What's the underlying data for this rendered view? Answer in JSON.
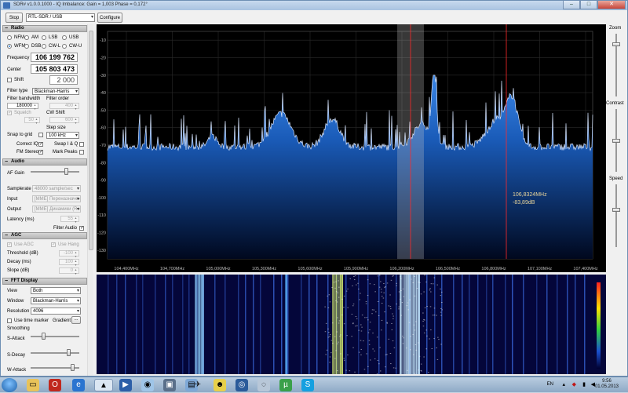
{
  "window": {
    "title": "SDR# v1.0.0.1000 - IQ Imbalance: Gain = 1,003 Phase = 0,172°",
    "minimize": "–",
    "maximize": "□",
    "close": "✕"
  },
  "toolbar": {
    "stop_label": "Stop",
    "device": "RTL-SDR / USB",
    "configure_label": "Configure"
  },
  "radio": {
    "header": "Radio",
    "modes": [
      {
        "label": "NFM",
        "selected": false
      },
      {
        "label": "AM",
        "selected": false
      },
      {
        "label": "LSB",
        "selected": false
      },
      {
        "label": "USB",
        "selected": false
      },
      {
        "label": "WFM",
        "selected": true
      },
      {
        "label": "DSB",
        "selected": false
      },
      {
        "label": "CW-L",
        "selected": false
      },
      {
        "label": "CW-U",
        "selected": false
      }
    ],
    "frequency_label": "Frequency",
    "frequency": "106 199 762",
    "center_label": "Center",
    "center": "105 803 473",
    "shift_label": "Shift",
    "shift": "2 000",
    "filter_type_label": "Filter type",
    "filter_type": "Blackman-Harris",
    "filter_bandwidth_label": "Filter bandwidth",
    "filter_bandwidth": "180000",
    "filter_order_label": "Filter order",
    "filter_order": "400",
    "squelch_label": "Squelch",
    "squelch": "50",
    "cw_shift_label": "CW Shift",
    "cw_shift": "600",
    "step_size_label": "Step size",
    "snap_label": "Snap to grid",
    "step_size": "100 kHz",
    "correct_iq_label": "Correct IQ",
    "swap_iq_label": "Swap I & Q",
    "fm_stereo_label": "FM Stereo",
    "mark_peaks_label": "Mark Peaks"
  },
  "audio": {
    "header": "Audio",
    "af_gain_label": "AF Gain",
    "af_gain": 0.75,
    "samplerate_label": "Samplerate",
    "samplerate": "48000 sample/sec",
    "input_label": "Input",
    "input": "[MME] Переназначени",
    "output_label": "Output",
    "output": "[MME] Динамики (Rea",
    "latency_label": "Latency (ms)",
    "latency": "55",
    "filter_audio_label": "Filter Audio"
  },
  "agc": {
    "header": "AGC",
    "use_agc_label": "Use AGC",
    "use_hang_label": "Use Hang",
    "threshold_label": "Threshold (dB)",
    "threshold": "-100",
    "decay_label": "Decay (ms)",
    "decay": "100",
    "slope_label": "Slope (dB)",
    "slope": "0"
  },
  "fft": {
    "header": "FFT Display",
    "view_label": "View",
    "view": "Both",
    "window_label": "Window",
    "window": "Blackman-Harris",
    "resolution_label": "Resolution",
    "resolution": "4096",
    "time_marker_label": "Use time marker",
    "gradient_label": "Gradient",
    "gradient_button": "...",
    "smoothing_label": "Smoothing",
    "s_attack_label": "S-Attack",
    "s_attack": 0.25,
    "s_decay_label": "S-Decay",
    "s_decay": 0.8,
    "w_attack_label": "W-Attack",
    "w_attack": 0.9
  },
  "spectrum": {
    "y_ticks": [
      "-10",
      "-20",
      "-30",
      "-40",
      "-50",
      "-60",
      "-70",
      "-80",
      "-90",
      "-100",
      "-110",
      "-120",
      "-130"
    ],
    "x_ticks": [
      "104,400MHz",
      "104,700MHz",
      "105,000MHz",
      "105,300MHz",
      "105,600MHz",
      "105,900MHz",
      "106,200MHz",
      "106,500MHz",
      "106,800MHz",
      "107,100MHz",
      "107,400MHz"
    ],
    "cursor_freq": "106,8324MHz",
    "cursor_level": "-83,89dB",
    "colors": {
      "fill_top": "#2b6fd0",
      "fill_bottom": "#001a4a",
      "trace": "#d8e6ff",
      "marker": "#ff2a2a"
    }
  },
  "right": {
    "zoom_label": "Zoom",
    "zoom": 0.85,
    "contrast_label": "Contrast",
    "contrast": 0.5,
    "speed_label": "Speed",
    "speed": 0.6
  },
  "taskbar": {
    "lang": "EN",
    "time": "9:56",
    "date": "01.05.2013"
  }
}
